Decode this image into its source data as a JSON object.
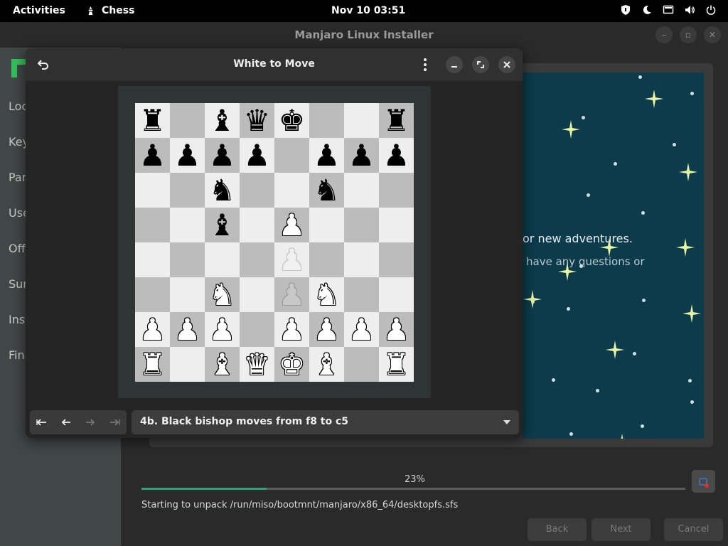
{
  "topbar": {
    "activities": "Activities",
    "app_name": "Chess",
    "clock": "Nov 10  03:51"
  },
  "installer": {
    "title": "Manjaro Linux Installer",
    "sidebar_items": [
      "Loc",
      "Key",
      "Par",
      "Use",
      "Off",
      "Sun",
      "Ins",
      "Fin"
    ],
    "slide_text_1": "or new adventures.",
    "slide_text_2": "have any questions or",
    "progress_label": "23%",
    "progress_value": 0.23,
    "status": "Starting to unpack /run/miso/bootmnt/manjaro/x86_64/desktopfs.sfs",
    "back": "Back",
    "next": "Next",
    "cancel": "Cancel",
    "slide_color": "#0c3b4c",
    "accent": "#2fa37e"
  },
  "chess": {
    "title": "White to Move",
    "move_label": "4b. Black bishop moves from f8 to c5",
    "ranks": [
      "r.bqk..r",
      "pppp.ppp",
      "..n..n..",
      "..b.P...",
      "........",
      "..N..N..",
      "PPP.PPPP",
      "R.BQKB.R"
    ],
    "ghost_squares": [
      "e4",
      "e3"
    ],
    "icons": {
      "undo": "undo-icon",
      "menu": "kebab-menu-icon",
      "minimize": "minimize-icon",
      "maximize": "maximize-icon",
      "close": "close-icon",
      "first": "first-move-icon",
      "prev": "previous-move-icon",
      "next": "next-move-icon",
      "last": "last-move-icon"
    }
  }
}
